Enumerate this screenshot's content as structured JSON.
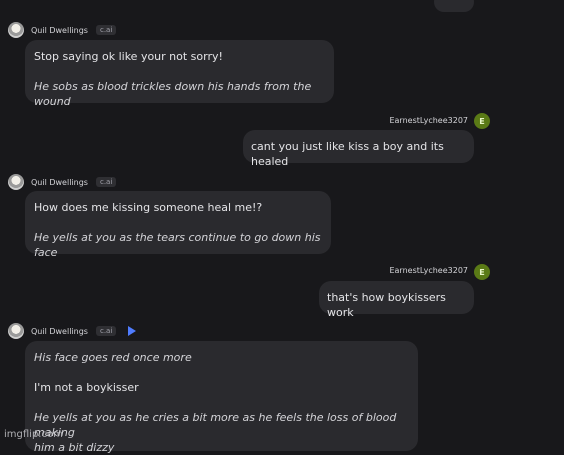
{
  "bot": {
    "name": "Quil Dwellings",
    "tag": "c.ai"
  },
  "user": {
    "name": "EarnestLychee3207",
    "avatar_letter": "E"
  },
  "messages": [
    {
      "speech": "Stop saying ok like your not sorry!",
      "action": "He sobs as blood trickles down his hands from the wound"
    },
    {
      "text": "cant you just like kiss a boy and its healed"
    },
    {
      "speech": "How does me kissing someone heal me!?",
      "action": "He yells at you as the tears continue to go down his face"
    },
    {
      "text": "that's how boykissers work"
    },
    {
      "line1": "His face goes red once more",
      "line2": "I'm not a boykisser",
      "line3": "He yells at you as he cries a bit more as he feels the loss of blood making",
      "line4": "him a bit dizzy"
    }
  ],
  "watermark": "imgflip.com",
  "icons": {
    "play": "play-icon"
  },
  "colors": {
    "background": "#18181b",
    "bubble": "#2a2a2e",
    "accent": "#4f7cff",
    "user_avatar": "#5a7a16"
  }
}
